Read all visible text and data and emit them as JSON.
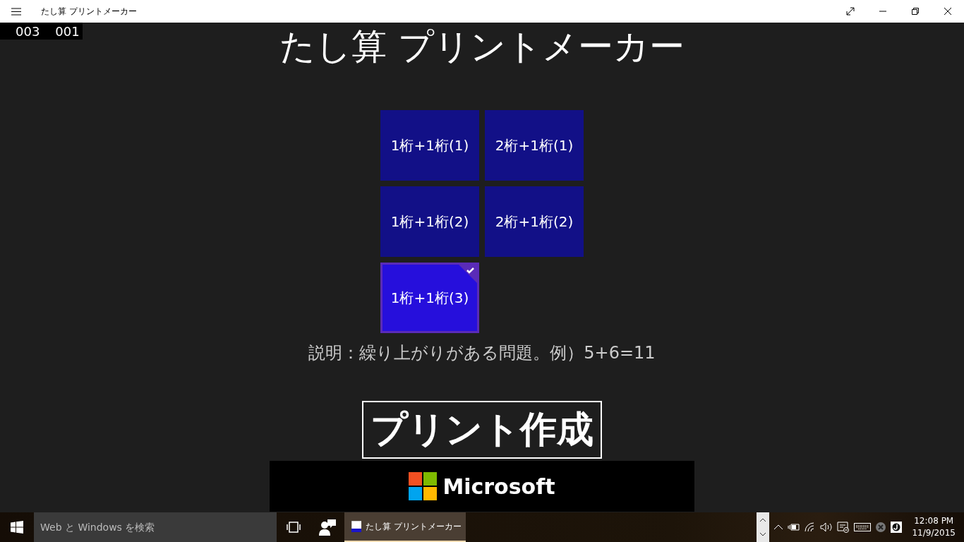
{
  "window": {
    "title": "たし算 プリントメーカー"
  },
  "counters": [
    "003",
    "001"
  ],
  "heading": "たし算 プリントメーカー",
  "tiles": [
    {
      "label": "1桁+1桁(1)",
      "selected": false
    },
    {
      "label": "2桁+1桁(1)",
      "selected": false
    },
    {
      "label": "1桁+1桁(2)",
      "selected": false
    },
    {
      "label": "2桁+1桁(2)",
      "selected": false
    },
    {
      "label": "1桁+1桁(3)",
      "selected": true
    }
  ],
  "description": "説明：繰り上がりがある問題。例）5+6=11",
  "print_button": "プリント作成",
  "ad": {
    "text": "Microsoft"
  },
  "taskbar": {
    "search": {
      "placeholder": "Web と Windows を検索"
    },
    "apps": [
      {
        "label": "たし算 プリントメーカー",
        "active": true
      }
    ],
    "clock": {
      "time": "12:08 PM",
      "date": "11/9/2015"
    }
  }
}
